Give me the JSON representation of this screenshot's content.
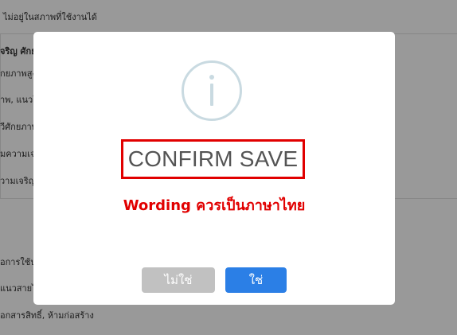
{
  "background": {
    "top_text": "ไม่อยู่ในสภาพที่ใช้งานได้",
    "left_fragments": [
      "จริญ ศักยภ",
      "กยภาพสูง",
      "าพ, แนวโ",
      "วีศักยภาพ",
      "มความเจร",
      "วามเจริญ",
      "อการใช้ปร",
      "แนวสายไฟ",
      "อกสารสิทธิ์, ห้ามก่อสร้าง"
    ]
  },
  "dialog": {
    "icon": "info-icon",
    "title": "CONFIRM SAVE",
    "annotation": "Wording ควรเป็นภาษาไทย",
    "buttons": {
      "no_label": "ไม่ใช่",
      "yes_label": "ใช่"
    }
  },
  "colors": {
    "overlay": "rgba(0,0,0,0.4)",
    "annotation_red": "#e10000",
    "primary_button": "#2b7fe6",
    "secondary_button": "#c1c1c1",
    "icon_ring": "#c9dae1"
  }
}
